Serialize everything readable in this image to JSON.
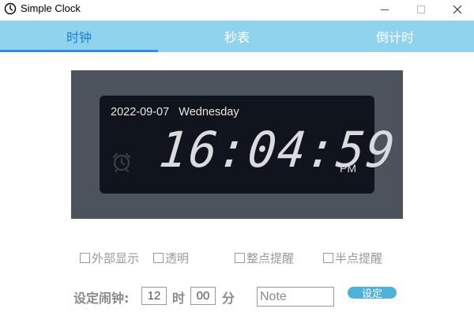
{
  "window": {
    "title": "Simple Clock",
    "icon": "clock-icon",
    "controls": {
      "minimize": "minimize-icon",
      "maximize": "maximize-icon",
      "close": "✕"
    }
  },
  "tabs": [
    {
      "label": "时钟",
      "active": true
    },
    {
      "label": "秒表",
      "active": false
    },
    {
      "label": "倒计时",
      "active": false
    }
  ],
  "clock": {
    "date": "2022-09-07",
    "weekday": "Wednesday",
    "time": "16:04:59",
    "ampm": "PM",
    "alarm_icon": "alarm-clock-icon"
  },
  "options": [
    {
      "label": "外部显示",
      "checked": false
    },
    {
      "label": "透明",
      "checked": false
    },
    {
      "label": "整点提醒",
      "checked": false
    },
    {
      "label": "半点提醒",
      "checked": false
    }
  ],
  "alarm_setting": {
    "label": "设定闹钟:",
    "hour": "12",
    "hour_unit": "时",
    "minute": "00",
    "minute_unit": "分",
    "note_placeholder": "Note",
    "set_button": "设定"
  },
  "colors": {
    "tab_bar": "#8fd3ec",
    "tab_active_text": "#1b7fd6",
    "clock_outer": "#4d535d",
    "clock_inner": "#0f141d",
    "button": "#4fb3d9"
  }
}
